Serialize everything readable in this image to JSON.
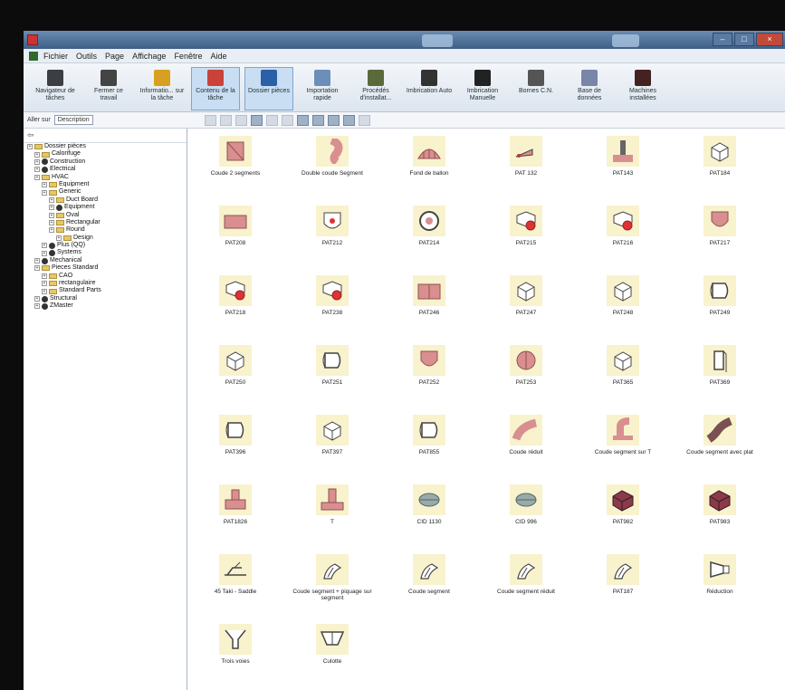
{
  "window": {
    "title": "",
    "controls": [
      "–",
      "□",
      "×"
    ]
  },
  "menu": [
    "Fichier",
    "Outils",
    "Page",
    "Affichage",
    "Fenêtre",
    "Aide"
  ],
  "ribbon": [
    {
      "label": "Navigateur de tâches",
      "color": "#3b3f44"
    },
    {
      "label": "Fermer ce travail",
      "color": "#444"
    },
    {
      "label": "Informatio... sur la tâche",
      "color": "#d8a020"
    },
    {
      "label": "Contenu de la tâche",
      "color": "#c9433a",
      "active": true
    },
    {
      "label": "Dossier pièces",
      "color": "#2b5fa8",
      "active": true
    },
    {
      "label": "Importation rapide",
      "color": "#6b8fb8"
    },
    {
      "label": "Procédés d'installat...",
      "color": "#5a6a3a"
    },
    {
      "label": "Imbrication Auto",
      "color": "#333"
    },
    {
      "label": "Imbrication Manuelle",
      "color": "#222"
    },
    {
      "label": "Bornes C.N.",
      "color": "#555"
    },
    {
      "label": "Base de données",
      "color": "#7a86a8"
    },
    {
      "label": "Machines installées",
      "color": "#442222"
    }
  ],
  "search": {
    "label": "Aller sur",
    "selected": "Description"
  },
  "tree": [
    {
      "level": 0,
      "label": "Dossier pièces",
      "type": "folder"
    },
    {
      "level": 1,
      "label": "Calorifuge",
      "type": "folder"
    },
    {
      "level": 1,
      "label": "Construction",
      "type": "dot"
    },
    {
      "level": 1,
      "label": "Electrical",
      "type": "dot"
    },
    {
      "level": 1,
      "label": "HVAC",
      "type": "folder"
    },
    {
      "level": 2,
      "label": "Equipment",
      "type": "folder"
    },
    {
      "level": 2,
      "label": "Generic",
      "type": "folder"
    },
    {
      "level": 3,
      "label": "Duct Board",
      "type": "folder"
    },
    {
      "level": 3,
      "label": "Equipment",
      "type": "dot"
    },
    {
      "level": 3,
      "label": "Oval",
      "type": "folder"
    },
    {
      "level": 3,
      "label": "Rectangular",
      "type": "folder"
    },
    {
      "level": 3,
      "label": "Round",
      "type": "folder"
    },
    {
      "level": 4,
      "label": "Design",
      "type": "folder"
    },
    {
      "level": 2,
      "label": "Plus (QQ)",
      "type": "dot"
    },
    {
      "level": 2,
      "label": "Systems",
      "type": "dot"
    },
    {
      "level": 1,
      "label": "Mechanical",
      "type": "dot"
    },
    {
      "level": 1,
      "label": "Pieces Standard",
      "type": "folder"
    },
    {
      "level": 2,
      "label": "CAO",
      "type": "folder"
    },
    {
      "level": 2,
      "label": "rectangulaire",
      "type": "folder"
    },
    {
      "level": 2,
      "label": "Standard Parts",
      "type": "folder"
    },
    {
      "level": 1,
      "label": "Structural",
      "type": "dot"
    },
    {
      "level": 1,
      "label": "ZMaster",
      "type": "dot"
    }
  ],
  "items": [
    {
      "label": "Coude 2 segments",
      "shape": "elbow2"
    },
    {
      "label": "Double coude Segment",
      "shape": "dblelbow"
    },
    {
      "label": "Fond de ballon",
      "shape": "dome"
    },
    {
      "label": "PAT 132",
      "shape": "cone"
    },
    {
      "label": "PAT143",
      "shape": "tee"
    },
    {
      "label": "PAT184",
      "shape": "box"
    },
    {
      "label": "PAT208",
      "shape": "flat"
    },
    {
      "label": "PAT212",
      "shape": "round"
    },
    {
      "label": "PAT214",
      "shape": "ring"
    },
    {
      "label": "PAT215",
      "shape": "reddot"
    },
    {
      "label": "PAT216",
      "shape": "reddot"
    },
    {
      "label": "PAT217",
      "shape": "shield"
    },
    {
      "label": "PAT218",
      "shape": "reddot"
    },
    {
      "label": "PAT238",
      "shape": "reddot"
    },
    {
      "label": "PAT246",
      "shape": "split"
    },
    {
      "label": "PAT247",
      "shape": "box"
    },
    {
      "label": "PAT248",
      "shape": "box"
    },
    {
      "label": "PAT249",
      "shape": "cyl"
    },
    {
      "label": "PAT250",
      "shape": "box"
    },
    {
      "label": "PAT251",
      "shape": "cyl"
    },
    {
      "label": "PAT252",
      "shape": "shield"
    },
    {
      "label": "PAT253",
      "shape": "halfcircle"
    },
    {
      "label": "PAT365",
      "shape": "box"
    },
    {
      "label": "PAT369",
      "shape": "plate"
    },
    {
      "label": "PAT396",
      "shape": "cyl"
    },
    {
      "label": "PAT397",
      "shape": "box"
    },
    {
      "label": "PAT855",
      "shape": "cyl"
    },
    {
      "label": "Coude réduit",
      "shape": "bend"
    },
    {
      "label": "Coude segment sur T",
      "shape": "bendT"
    },
    {
      "label": "Coude segment avec plat",
      "shape": "bendflat"
    },
    {
      "label": "PAT1826",
      "shape": "teeup"
    },
    {
      "label": "T",
      "shape": "bigT"
    },
    {
      "label": "CID 1130",
      "shape": "oval"
    },
    {
      "label": "CID 996",
      "shape": "oval"
    },
    {
      "label": "PAT982",
      "shape": "purple"
    },
    {
      "label": "PAT983",
      "shape": "purple"
    },
    {
      "label": "45 Taki - Saddle",
      "shape": "saddle"
    },
    {
      "label": "Coude segment + piquage sur segment",
      "shape": "wire"
    },
    {
      "label": "Coude segment",
      "shape": "wire"
    },
    {
      "label": "Coude segment réduit",
      "shape": "wire"
    },
    {
      "label": "PAT187",
      "shape": "wire"
    },
    {
      "label": "Réduction",
      "shape": "reduc"
    },
    {
      "label": "Trois voies",
      "shape": "wye"
    },
    {
      "label": "Culotte",
      "shape": "culotte"
    }
  ],
  "colors": {
    "pink": "#d98f8f",
    "pinkdark": "#8f5050",
    "purple": "#8a3a4a",
    "thumbbg": "#f8f2cd"
  }
}
